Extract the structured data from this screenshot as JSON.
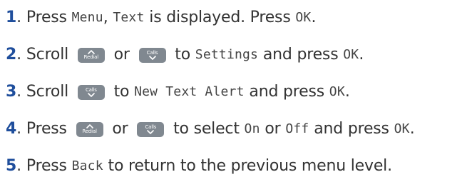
{
  "steps": [
    {
      "number": "1",
      "parts": [
        {
          "type": "text",
          "value": "Press "
        },
        {
          "type": "mono",
          "value": "Menu"
        },
        {
          "type": "text",
          "value": ", "
        },
        {
          "type": "mono",
          "value": "Text"
        },
        {
          "type": "text",
          "value": " is displayed. Press "
        },
        {
          "type": "mono",
          "value": "OK"
        },
        {
          "type": "text",
          "value": "."
        }
      ]
    },
    {
      "number": "2",
      "parts": [
        {
          "type": "text",
          "value": "Scroll "
        },
        {
          "type": "key",
          "key": "redial"
        },
        {
          "type": "text",
          "value": " or "
        },
        {
          "type": "key",
          "key": "calls"
        },
        {
          "type": "text",
          "value": " to "
        },
        {
          "type": "mono",
          "value": "Settings"
        },
        {
          "type": "text",
          "value": " and press "
        },
        {
          "type": "mono",
          "value": "OK"
        },
        {
          "type": "text",
          "value": "."
        }
      ]
    },
    {
      "number": "3",
      "parts": [
        {
          "type": "text",
          "value": "Scroll "
        },
        {
          "type": "key",
          "key": "calls"
        },
        {
          "type": "text",
          "value": " to "
        },
        {
          "type": "mono",
          "value": "New Text Alert"
        },
        {
          "type": "text",
          "value": " and press "
        },
        {
          "type": "mono",
          "value": "OK"
        },
        {
          "type": "text",
          "value": "."
        }
      ]
    },
    {
      "number": "4",
      "parts": [
        {
          "type": "text",
          "value": "Press "
        },
        {
          "type": "key",
          "key": "redial"
        },
        {
          "type": "text",
          "value": " or "
        },
        {
          "type": "key",
          "key": "calls"
        },
        {
          "type": "text",
          "value": " to select "
        },
        {
          "type": "mono",
          "value": "On"
        },
        {
          "type": "text",
          "value": " or "
        },
        {
          "type": "mono",
          "value": "Off"
        },
        {
          "type": "text",
          "value": " and press "
        },
        {
          "type": "mono",
          "value": "OK"
        },
        {
          "type": "text",
          "value": "."
        }
      ]
    },
    {
      "number": "5",
      "parts": [
        {
          "type": "text",
          "value": "Press "
        },
        {
          "type": "mono",
          "value": "Back"
        },
        {
          "type": "text",
          "value": " to return to the previous menu level."
        }
      ]
    }
  ],
  "keys": {
    "redial": {
      "label": "Redial",
      "icon": "caret-up-icon"
    },
    "calls": {
      "label": "Calls",
      "icon": "caret-down-icon"
    }
  },
  "colors": {
    "step_number": "#1f4e9c",
    "body_text": "#333333",
    "key_background": "#808890",
    "key_text": "#ffffff"
  }
}
